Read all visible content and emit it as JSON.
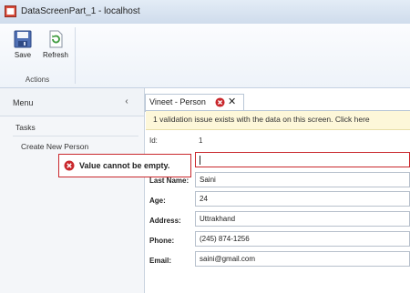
{
  "window": {
    "title": "DataScreenPart_1 - localhost"
  },
  "ribbon": {
    "save_label": "Save",
    "refresh_label": "Refresh",
    "group_label": "Actions"
  },
  "menu": {
    "title": "Menu",
    "collapse_glyph": "‹",
    "section": "Tasks",
    "items": [
      {
        "label": "Create New Person"
      }
    ]
  },
  "tab": {
    "label": "Vineet - Person",
    "close_glyph": "✕"
  },
  "banner": {
    "text": "1 validation issue exists with the data on this screen. Click here"
  },
  "form": {
    "id_label": "Id:",
    "id_value": "1",
    "name_value": "",
    "last_name_label": "Last Name:",
    "last_name_value": "Saini",
    "age_label": "Age:",
    "age_value": "24",
    "address_label": "Address:",
    "address_value": "Uttrakhand",
    "phone_label": "Phone:",
    "phone_value": "(245) 874-1256",
    "email_label": "Email:",
    "email_value": "saini@gmail.com"
  },
  "validation": {
    "message": "Value cannot be empty."
  },
  "colors": {
    "error": "#c9282d",
    "banner_bg": "#fdf7d9"
  }
}
